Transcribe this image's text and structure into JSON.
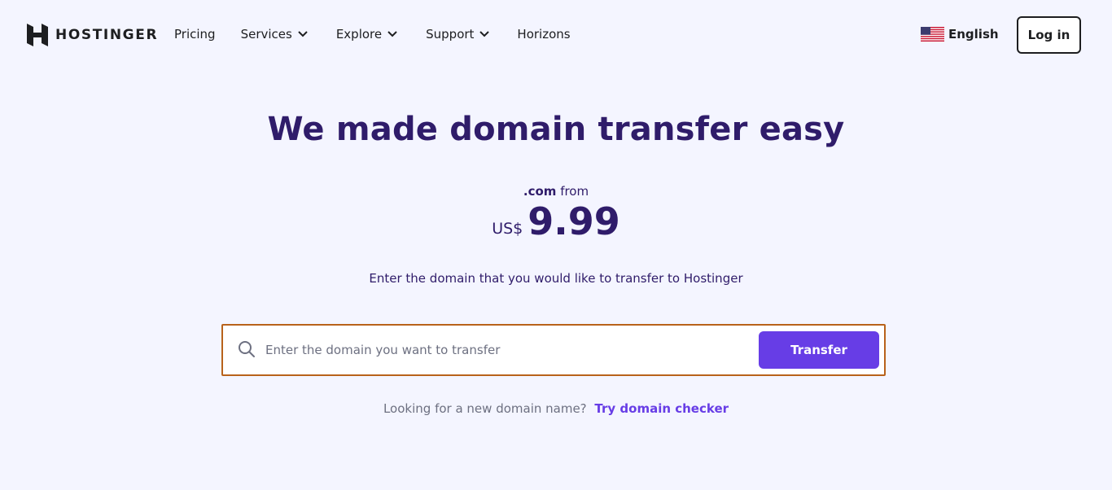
{
  "brand": {
    "name": "HOSTINGER",
    "logo_icon": "hostinger-h-logo"
  },
  "nav": {
    "items": [
      {
        "label": "Pricing",
        "has_dropdown": false
      },
      {
        "label": "Services",
        "has_dropdown": true
      },
      {
        "label": "Explore",
        "has_dropdown": true
      },
      {
        "label": "Support",
        "has_dropdown": true
      },
      {
        "label": "Horizons",
        "has_dropdown": false
      }
    ]
  },
  "language": {
    "label": "English",
    "flag_icon": "us-flag-icon"
  },
  "login": {
    "label": "Log in"
  },
  "hero": {
    "title": "We made domain transfer easy",
    "tld": ".com",
    "from_text": "from",
    "currency": "US$",
    "price": "9.99",
    "instruction": "Enter the domain that you would like to transfer to Hostinger"
  },
  "search": {
    "placeholder": "Enter the domain you want to transfer",
    "value": "",
    "button_label": "Transfer"
  },
  "helper": {
    "text": "Looking for a new domain name?",
    "link_label": "Try domain checker"
  },
  "colors": {
    "background": "#f4f5ff",
    "primary": "#673de6",
    "heading": "#2f1c6a",
    "focus_outline": "#b8621b"
  }
}
